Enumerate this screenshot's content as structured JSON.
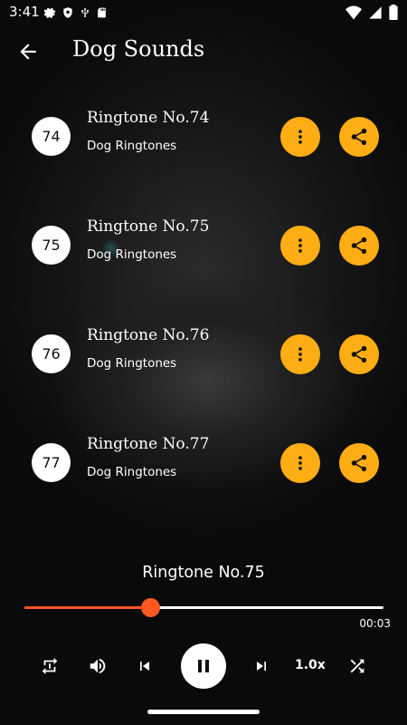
{
  "status": {
    "time": "3:41",
    "left_icons": [
      "gear-icon",
      "shield-icon",
      "usb-icon",
      "sd-card-icon"
    ],
    "right_icons": [
      "wifi-icon",
      "signal-icon",
      "battery-icon"
    ]
  },
  "appbar": {
    "title": "Dog Sounds",
    "back_icon": "arrow-back-icon"
  },
  "ringtones": [
    {
      "number": "74",
      "title": "Ringtone No.74",
      "subtitle": "Dog Ringtones"
    },
    {
      "number": "75",
      "title": "Ringtone No.75",
      "subtitle": "Dog Ringtones"
    },
    {
      "number": "76",
      "title": "Ringtone No.76",
      "subtitle": "Dog Ringtones"
    },
    {
      "number": "77",
      "title": "Ringtone No.77",
      "subtitle": "Dog Ringtones"
    }
  ],
  "player": {
    "now_playing": "Ringtone No.75",
    "elapsed": "00:03",
    "progress_fraction": 0.35,
    "speed": "1.0x",
    "controls": [
      "repeat-icon",
      "volume-icon",
      "previous-icon",
      "pause-icon",
      "next-icon",
      "speed",
      "shuffle-icon"
    ]
  },
  "colors": {
    "accent": "#ffad14",
    "progress": "#ff5722"
  }
}
